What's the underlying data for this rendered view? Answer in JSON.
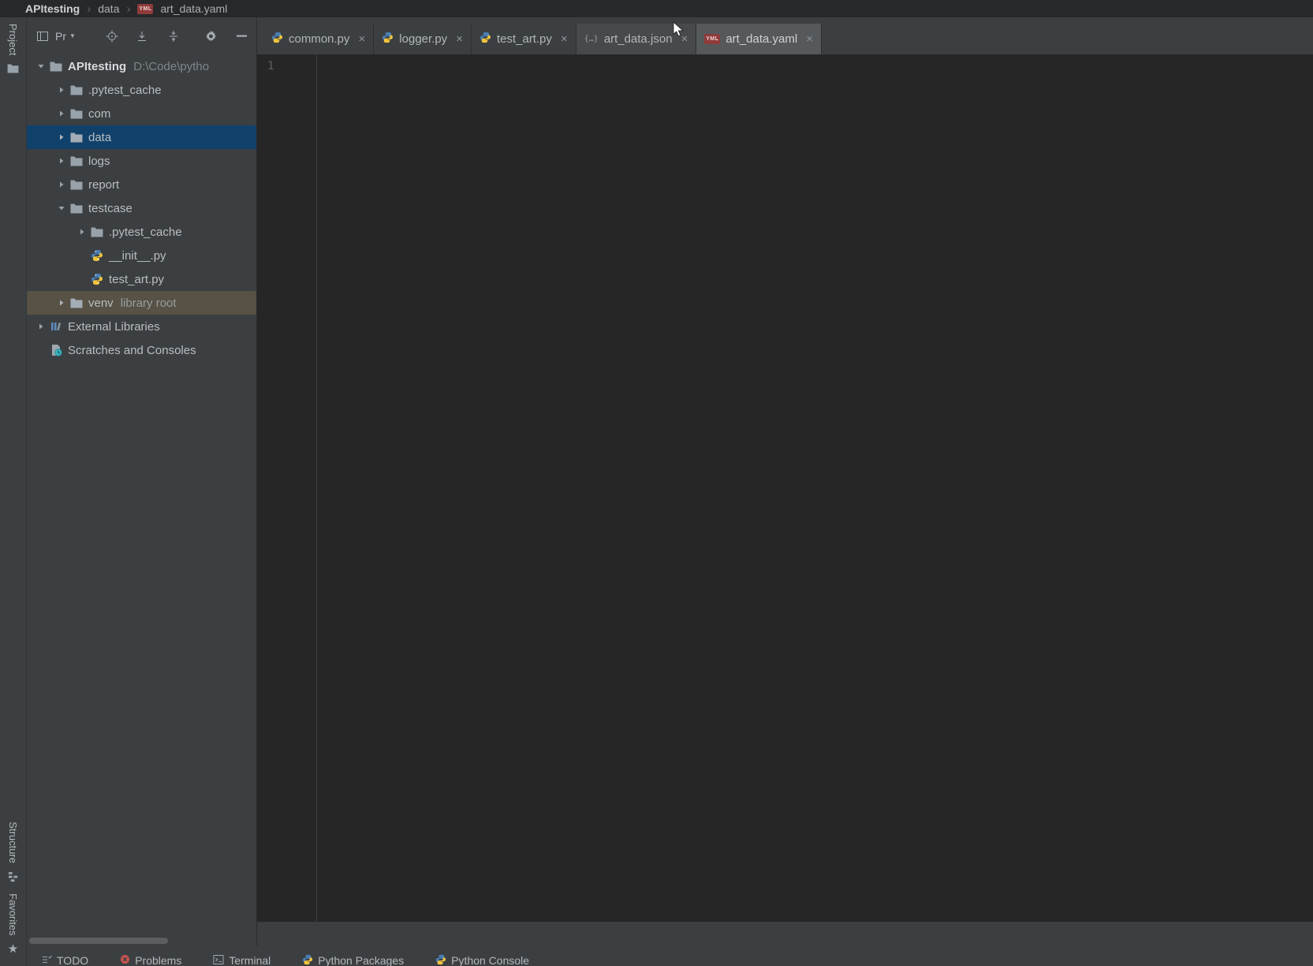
{
  "breadcrumb": {
    "project": "APItesting",
    "folder": "data",
    "file": "art_data.yaml"
  },
  "tool_strip": {
    "project": "Project",
    "structure": "Structure",
    "favorites": "Favorites"
  },
  "project_panel": {
    "view_selector": "Pr",
    "tree": [
      {
        "label": "APItesting",
        "secondary": "D:\\Code\\pytho"
      },
      {
        "label": ".pytest_cache"
      },
      {
        "label": "com"
      },
      {
        "label": "data"
      },
      {
        "label": "logs"
      },
      {
        "label": "report"
      },
      {
        "label": "testcase"
      },
      {
        "label": ".pytest_cache"
      },
      {
        "label": "__init__.py"
      },
      {
        "label": "test_art.py"
      },
      {
        "label": "venv",
        "secondary": "library root"
      },
      {
        "label": "External Libraries"
      },
      {
        "label": "Scratches and Consoles"
      }
    ]
  },
  "tabs": [
    {
      "label": "common.py"
    },
    {
      "label": "logger.py"
    },
    {
      "label": "test_art.py"
    },
    {
      "label": "art_data.json"
    },
    {
      "label": "art_data.yaml"
    }
  ],
  "editor": {
    "line_number": "1"
  },
  "bottom_bar": {
    "items": [
      {
        "label": "TODO"
      },
      {
        "label": "Problems"
      },
      {
        "label": "Terminal"
      },
      {
        "label": "Python Packages"
      },
      {
        "label": "Python Console"
      }
    ]
  },
  "icons": {
    "yaml_badge": "YML",
    "json_braces": "{…}",
    "close": "×",
    "separator": "›",
    "star": "★",
    "dropdown": "▼"
  },
  "colors": {
    "selection_blue": "#10416a",
    "library_root_highlight": "#575146",
    "active_tab_bg": "#55595b",
    "editor_bg": "#262626",
    "frame_bg": "#3c3f41",
    "yaml_badge_bg": "#8f3b3b",
    "python_blue": "#4a7fb5",
    "python_yellow": "#f2c53d"
  }
}
